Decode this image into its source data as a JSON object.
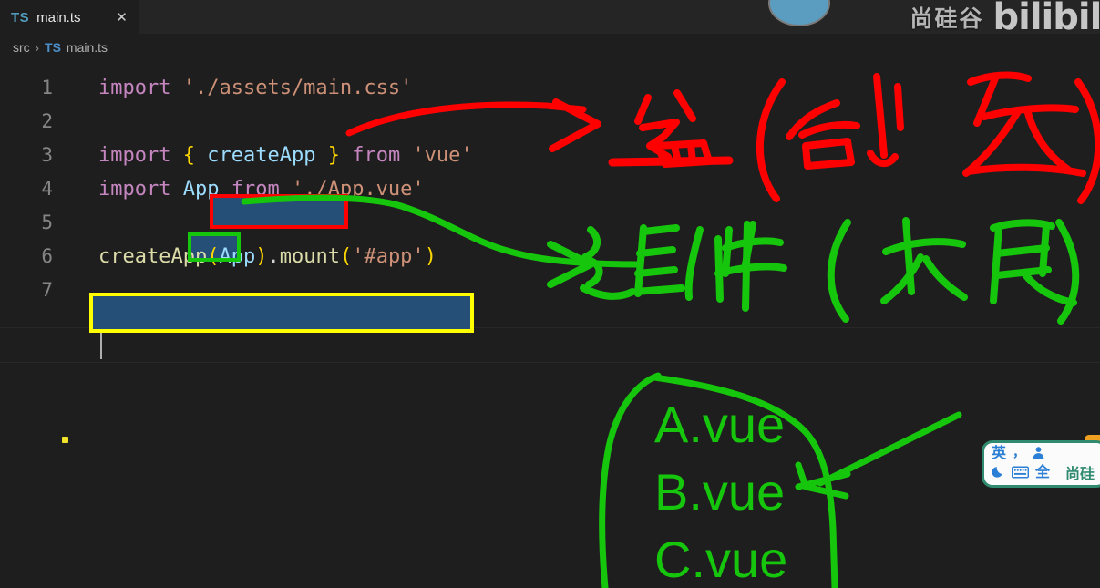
{
  "window": {
    "background": "#1e1e1e"
  },
  "tabbar": {
    "active_tab": {
      "icon": "typescript-file-icon",
      "icon_text": "TS",
      "label": "main.ts",
      "close_label": "✕"
    }
  },
  "watermark": {
    "channel_name": "尚硅谷",
    "platform": "bilibili",
    "avatar": "presenter-avatar"
  },
  "breadcrumb": {
    "root": "src",
    "separator": "›",
    "file_icon_text": "TS",
    "file": "main.ts"
  },
  "editor": {
    "language": "typescript",
    "line_numbers": [
      "1",
      "2",
      "3",
      "4",
      "5",
      "6",
      "7"
    ],
    "lines": [
      {
        "n": "1",
        "tokens": [
          {
            "t": "import",
            "c": "kw"
          },
          {
            "t": " ",
            "c": "punct"
          },
          {
            "t": "'./assets/main.css'",
            "c": "str"
          }
        ]
      },
      {
        "n": "2",
        "tokens": []
      },
      {
        "n": "3",
        "tokens": [
          {
            "t": "import",
            "c": "kw"
          },
          {
            "t": " ",
            "c": "punct"
          },
          {
            "t": "{",
            "c": "brace"
          },
          {
            "t": " ",
            "c": "punct"
          },
          {
            "t": "createApp",
            "c": "ident"
          },
          {
            "t": " ",
            "c": "punct"
          },
          {
            "t": "}",
            "c": "brace"
          },
          {
            "t": " ",
            "c": "punct"
          },
          {
            "t": "from",
            "c": "kw"
          },
          {
            "t": " ",
            "c": "punct"
          },
          {
            "t": "'vue'",
            "c": "str"
          }
        ]
      },
      {
        "n": "4",
        "tokens": [
          {
            "t": "import",
            "c": "kw"
          },
          {
            "t": " ",
            "c": "punct"
          },
          {
            "t": "App",
            "c": "ident"
          },
          {
            "t": " ",
            "c": "punct"
          },
          {
            "t": "from",
            "c": "kw"
          },
          {
            "t": " ",
            "c": "punct"
          },
          {
            "t": "'./App.vue'",
            "c": "str"
          }
        ]
      },
      {
        "n": "5",
        "tokens": []
      },
      {
        "n": "6",
        "tokens": [
          {
            "t": "createApp",
            "c": "fn"
          },
          {
            "t": "(",
            "c": "paren"
          },
          {
            "t": "App",
            "c": "ident"
          },
          {
            "t": ")",
            "c": "paren"
          },
          {
            "t": ".",
            "c": "punct"
          },
          {
            "t": "mount",
            "c": "fn"
          },
          {
            "t": "(",
            "c": "paren"
          },
          {
            "t": "'#app'",
            "c": "str"
          },
          {
            "t": ")",
            "c": "paren"
          }
        ]
      },
      {
        "n": "7",
        "tokens": []
      }
    ],
    "line1_text": "import './assets/main.css'",
    "line3_text": "import { createApp } from 'vue'",
    "line4_text": "import App from './App.vue'",
    "line6_text": "createApp(App).mount('#app')",
    "cursor_line": "7",
    "breakpoint_dot": "yellow-marker-dot"
  },
  "annotations": {
    "red_box_target": "createApp",
    "green_box_target": "App",
    "yellow_box_target": "createApp(App).mount('#app')",
    "red_note": "盆（创 应）",
    "red_note_chars": [
      "盆",
      "（",
      "创",
      "应",
      "）"
    ],
    "green_note": "组件（根）",
    "green_note_chars": [
      "组",
      "件",
      "（",
      "根",
      "）"
    ],
    "component_list": [
      "A.vue",
      "B.vue",
      "C.vue"
    ],
    "colors": {
      "red": "#ff0000",
      "green": "#16c60c",
      "yellow": "#ffff00"
    }
  },
  "ime": {
    "mode_label": "英",
    "punct_label": "，",
    "user_icon": "user-icon",
    "moon_icon": "moon-icon",
    "keyboard_icon": "keyboard-icon",
    "width_label": "全",
    "brand": "尚硅",
    "accent": "#2f8a6f"
  }
}
